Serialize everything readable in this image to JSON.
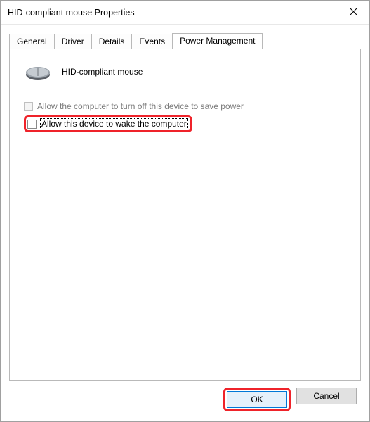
{
  "window": {
    "title": "HID-compliant mouse Properties"
  },
  "tabs": {
    "general": "General",
    "driver": "Driver",
    "details": "Details",
    "events": "Events",
    "power": "Power Management"
  },
  "panel": {
    "device_name": "HID-compliant mouse",
    "allow_turn_off_label": "Allow the computer to turn off this device to save power",
    "allow_wake_label": "Allow this device to wake the computer"
  },
  "buttons": {
    "ok": "OK",
    "cancel": "Cancel"
  }
}
